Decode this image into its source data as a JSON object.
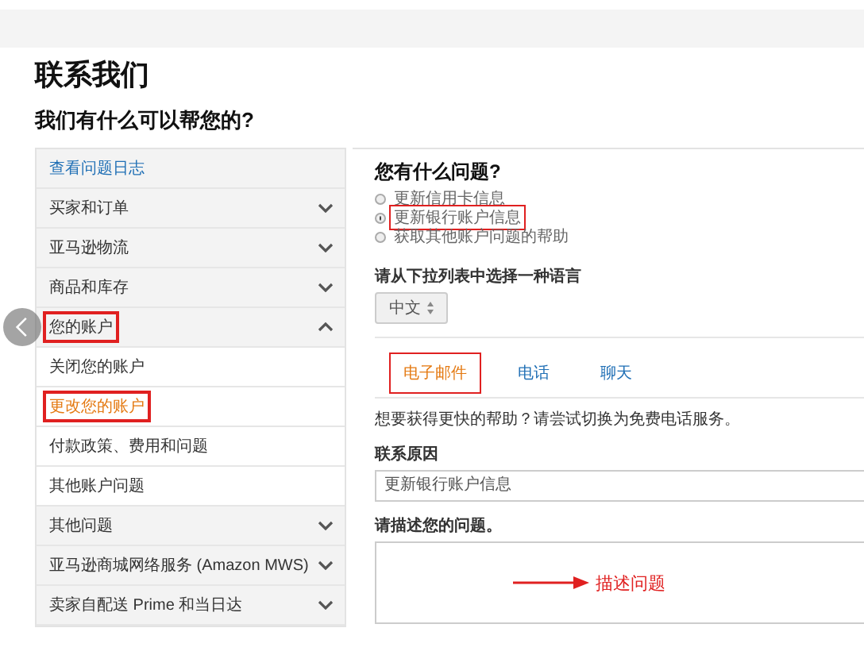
{
  "page": {
    "title": "联系我们",
    "subtitle": "我们有什么可以帮您的?"
  },
  "sidebar": {
    "items": [
      {
        "kind": "link",
        "label": "查看问题日志"
      },
      {
        "kind": "section",
        "label": "买家和订单",
        "expanded": false,
        "highlighted": false
      },
      {
        "kind": "section",
        "label": "亚马逊物流",
        "expanded": false,
        "highlighted": false
      },
      {
        "kind": "section",
        "label": "商品和库存",
        "expanded": false,
        "highlighted": false
      },
      {
        "kind": "section",
        "label": "您的账户",
        "expanded": true,
        "highlighted": true,
        "children": [
          {
            "label": "关闭您的账户",
            "selected": false,
            "highlighted": false
          },
          {
            "label": "更改您的账户",
            "selected": true,
            "highlighted": true
          },
          {
            "label": "付款政策、费用和问题",
            "selected": false,
            "highlighted": false
          },
          {
            "label": "其他账户问题",
            "selected": false,
            "highlighted": false
          }
        ]
      },
      {
        "kind": "section",
        "label": "其他问题",
        "expanded": false,
        "highlighted": false
      },
      {
        "kind": "section",
        "label": "亚马逊商城网络服务 (Amazon MWS)",
        "expanded": false,
        "highlighted": false
      },
      {
        "kind": "section",
        "label": "卖家自配送 Prime 和当日达",
        "expanded": false,
        "highlighted": false
      }
    ]
  },
  "question": {
    "heading": "您有什么问题?",
    "options": [
      {
        "label": "更新信用卡信息",
        "selected": false,
        "highlighted": false
      },
      {
        "label": "更新银行账户信息",
        "selected": true,
        "highlighted": true
      },
      {
        "label": "获取其他账户问题的帮助",
        "selected": false,
        "highlighted": false
      }
    ]
  },
  "language": {
    "label": "请从下拉列表中选择一种语言",
    "value": "中文"
  },
  "tabs": [
    {
      "label": "电子邮件",
      "selected": true,
      "highlighted": true
    },
    {
      "label": "电话",
      "selected": false,
      "highlighted": false
    },
    {
      "label": "聊天",
      "selected": false,
      "highlighted": false
    }
  ],
  "form": {
    "hint": "想要获得更快的帮助？请尝试切换为免费电话服务。",
    "reason_label": "联系原因",
    "reason_value": "更新银行账户信息",
    "describe_label": "请描述您的问题。",
    "annotation": "描述问题"
  }
}
